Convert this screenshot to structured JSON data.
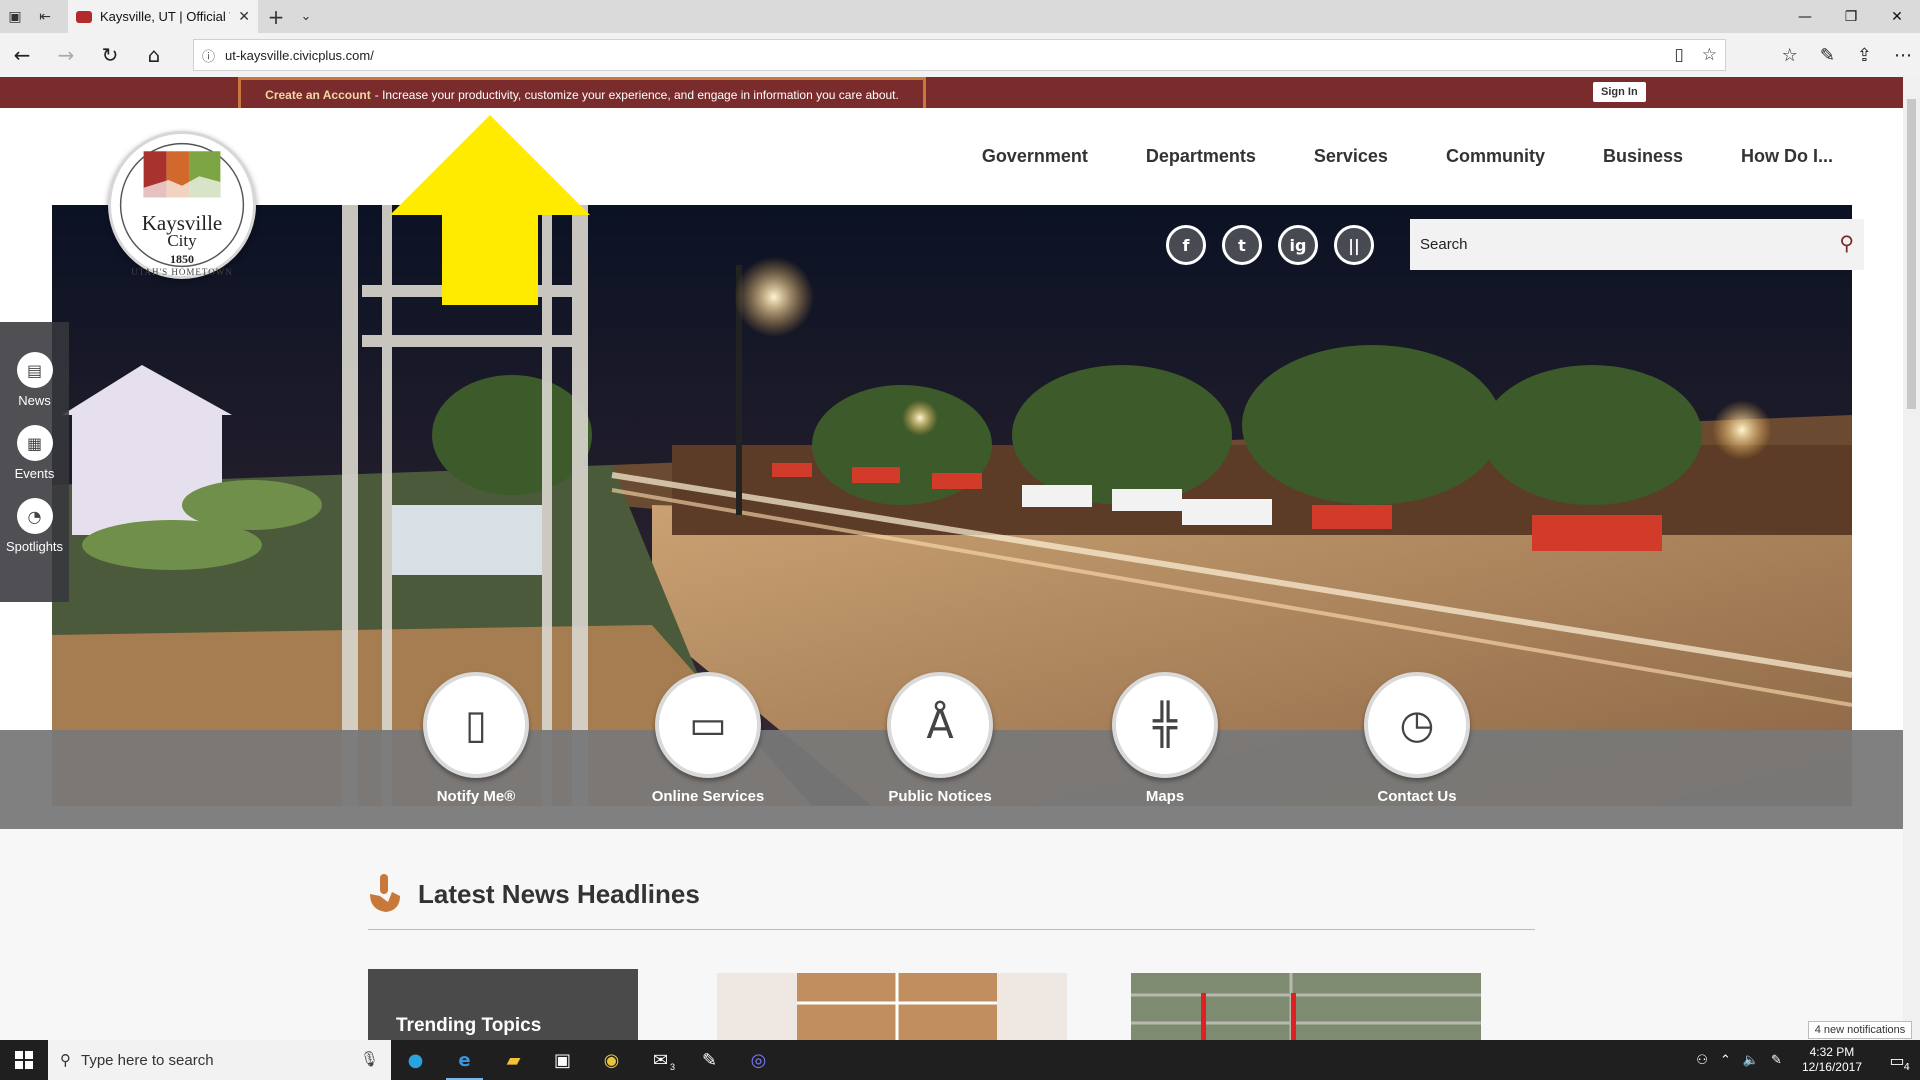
{
  "browser": {
    "tab_title": "Kaysville, UT | Official W",
    "url": "ut-kaysville.civicplus.com/"
  },
  "account_bar": {
    "create_link": "Create an Account",
    "message": "- Increase your productivity, customize your experience, and engage in information you care about.",
    "sign_in": "Sign In"
  },
  "logo": {
    "name_line1": "Kaysville",
    "name_line2": "City",
    "year": "1850",
    "motto": "UTAH'S HOMETOWN"
  },
  "nav": {
    "items": [
      "Government",
      "Departments",
      "Services",
      "Community",
      "Business",
      "How Do I..."
    ]
  },
  "social": [
    "f",
    "t",
    "ig",
    "||"
  ],
  "search": {
    "placeholder": "Search"
  },
  "sidebar": {
    "items": [
      {
        "label": "News",
        "icon": "newspaper-icon"
      },
      {
        "label": "Events",
        "icon": "calendar-icon"
      },
      {
        "label": "Spotlights",
        "icon": "spotlight-icon"
      }
    ]
  },
  "quick_links": [
    {
      "label": "Notify Me®",
      "icon": "phone-icon"
    },
    {
      "label": "Online Services",
      "icon": "computer-icon"
    },
    {
      "label": "Public Notices",
      "icon": "antenna-icon"
    },
    {
      "label": "Maps",
      "icon": "signpost-icon"
    },
    {
      "label": "Contact Us",
      "icon": "clock-phone-icon"
    }
  ],
  "news": {
    "heading": "Latest News Headlines",
    "trending": "Trending Topics"
  },
  "notification_toast": "4 new notifications",
  "taskbar": {
    "search_placeholder": "Type here to search",
    "time": "4:32 PM",
    "date": "12/16/2017",
    "notification_count": "4",
    "mail_badge": "3"
  },
  "colors": {
    "brand_maroon": "#7a2c2c",
    "accent_orange": "#c8783a",
    "arrow_yellow": "#ffeb00",
    "quickbar_gray": "#787878"
  }
}
